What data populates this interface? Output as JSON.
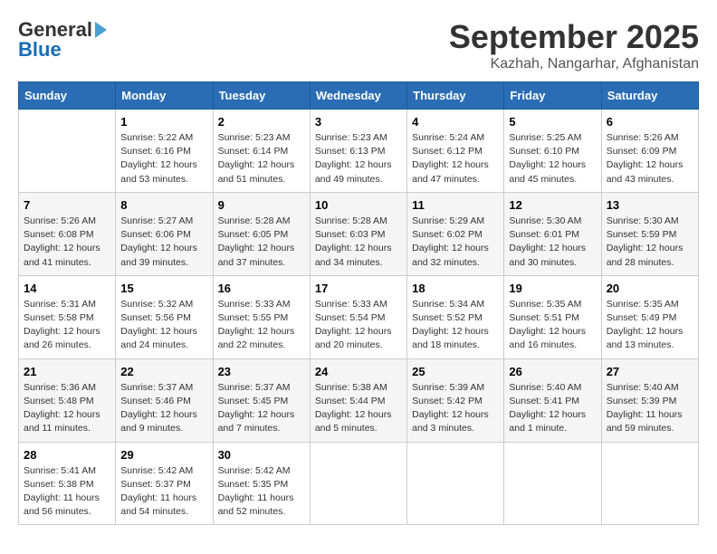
{
  "header": {
    "logo_general": "General",
    "logo_blue": "Blue",
    "month_year": "September 2025",
    "location": "Kazhah, Nangarhar, Afghanistan"
  },
  "days_of_week": [
    "Sunday",
    "Monday",
    "Tuesday",
    "Wednesday",
    "Thursday",
    "Friday",
    "Saturday"
  ],
  "weeks": [
    [
      {
        "day": "",
        "info": ""
      },
      {
        "day": "1",
        "info": "Sunrise: 5:22 AM\nSunset: 6:16 PM\nDaylight: 12 hours\nand 53 minutes."
      },
      {
        "day": "2",
        "info": "Sunrise: 5:23 AM\nSunset: 6:14 PM\nDaylight: 12 hours\nand 51 minutes."
      },
      {
        "day": "3",
        "info": "Sunrise: 5:23 AM\nSunset: 6:13 PM\nDaylight: 12 hours\nand 49 minutes."
      },
      {
        "day": "4",
        "info": "Sunrise: 5:24 AM\nSunset: 6:12 PM\nDaylight: 12 hours\nand 47 minutes."
      },
      {
        "day": "5",
        "info": "Sunrise: 5:25 AM\nSunset: 6:10 PM\nDaylight: 12 hours\nand 45 minutes."
      },
      {
        "day": "6",
        "info": "Sunrise: 5:26 AM\nSunset: 6:09 PM\nDaylight: 12 hours\nand 43 minutes."
      }
    ],
    [
      {
        "day": "7",
        "info": "Sunrise: 5:26 AM\nSunset: 6:08 PM\nDaylight: 12 hours\nand 41 minutes."
      },
      {
        "day": "8",
        "info": "Sunrise: 5:27 AM\nSunset: 6:06 PM\nDaylight: 12 hours\nand 39 minutes."
      },
      {
        "day": "9",
        "info": "Sunrise: 5:28 AM\nSunset: 6:05 PM\nDaylight: 12 hours\nand 37 minutes."
      },
      {
        "day": "10",
        "info": "Sunrise: 5:28 AM\nSunset: 6:03 PM\nDaylight: 12 hours\nand 34 minutes."
      },
      {
        "day": "11",
        "info": "Sunrise: 5:29 AM\nSunset: 6:02 PM\nDaylight: 12 hours\nand 32 minutes."
      },
      {
        "day": "12",
        "info": "Sunrise: 5:30 AM\nSunset: 6:01 PM\nDaylight: 12 hours\nand 30 minutes."
      },
      {
        "day": "13",
        "info": "Sunrise: 5:30 AM\nSunset: 5:59 PM\nDaylight: 12 hours\nand 28 minutes."
      }
    ],
    [
      {
        "day": "14",
        "info": "Sunrise: 5:31 AM\nSunset: 5:58 PM\nDaylight: 12 hours\nand 26 minutes."
      },
      {
        "day": "15",
        "info": "Sunrise: 5:32 AM\nSunset: 5:56 PM\nDaylight: 12 hours\nand 24 minutes."
      },
      {
        "day": "16",
        "info": "Sunrise: 5:33 AM\nSunset: 5:55 PM\nDaylight: 12 hours\nand 22 minutes."
      },
      {
        "day": "17",
        "info": "Sunrise: 5:33 AM\nSunset: 5:54 PM\nDaylight: 12 hours\nand 20 minutes."
      },
      {
        "day": "18",
        "info": "Sunrise: 5:34 AM\nSunset: 5:52 PM\nDaylight: 12 hours\nand 18 minutes."
      },
      {
        "day": "19",
        "info": "Sunrise: 5:35 AM\nSunset: 5:51 PM\nDaylight: 12 hours\nand 16 minutes."
      },
      {
        "day": "20",
        "info": "Sunrise: 5:35 AM\nSunset: 5:49 PM\nDaylight: 12 hours\nand 13 minutes."
      }
    ],
    [
      {
        "day": "21",
        "info": "Sunrise: 5:36 AM\nSunset: 5:48 PM\nDaylight: 12 hours\nand 11 minutes."
      },
      {
        "day": "22",
        "info": "Sunrise: 5:37 AM\nSunset: 5:46 PM\nDaylight: 12 hours\nand 9 minutes."
      },
      {
        "day": "23",
        "info": "Sunrise: 5:37 AM\nSunset: 5:45 PM\nDaylight: 12 hours\nand 7 minutes."
      },
      {
        "day": "24",
        "info": "Sunrise: 5:38 AM\nSunset: 5:44 PM\nDaylight: 12 hours\nand 5 minutes."
      },
      {
        "day": "25",
        "info": "Sunrise: 5:39 AM\nSunset: 5:42 PM\nDaylight: 12 hours\nand 3 minutes."
      },
      {
        "day": "26",
        "info": "Sunrise: 5:40 AM\nSunset: 5:41 PM\nDaylight: 12 hours\nand 1 minute."
      },
      {
        "day": "27",
        "info": "Sunrise: 5:40 AM\nSunset: 5:39 PM\nDaylight: 11 hours\nand 59 minutes."
      }
    ],
    [
      {
        "day": "28",
        "info": "Sunrise: 5:41 AM\nSunset: 5:38 PM\nDaylight: 11 hours\nand 56 minutes."
      },
      {
        "day": "29",
        "info": "Sunrise: 5:42 AM\nSunset: 5:37 PM\nDaylight: 11 hours\nand 54 minutes."
      },
      {
        "day": "30",
        "info": "Sunrise: 5:42 AM\nSunset: 5:35 PM\nDaylight: 11 hours\nand 52 minutes."
      },
      {
        "day": "",
        "info": ""
      },
      {
        "day": "",
        "info": ""
      },
      {
        "day": "",
        "info": ""
      },
      {
        "day": "",
        "info": ""
      }
    ]
  ]
}
